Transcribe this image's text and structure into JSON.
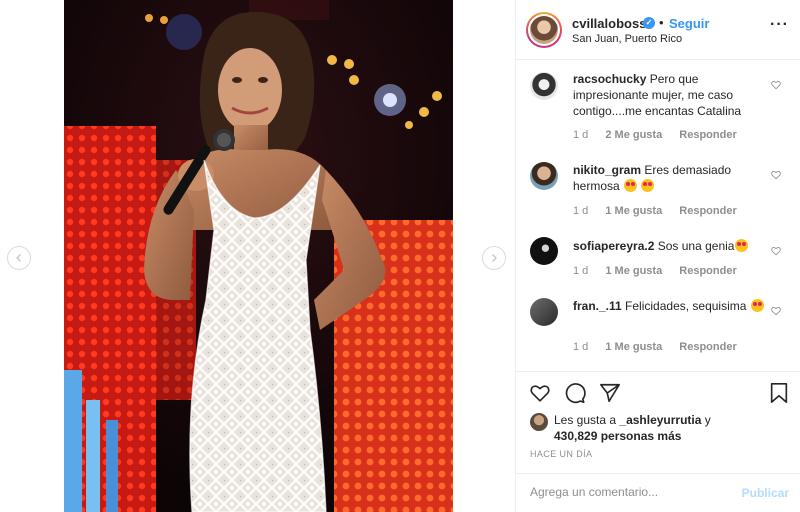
{
  "nav": {
    "prev_icon": "chevron-left-icon",
    "next_icon": "chevron-right-icon"
  },
  "post": {
    "username": "cvillaloboss",
    "dot": "•",
    "follow_label": "Seguir",
    "location": "San Juan, Puerto Rico",
    "more": "···"
  },
  "comments": [
    {
      "user": "racsochucky",
      "text": "Pero que impresionante mujer, me caso contigo....me encantas Catalina",
      "emojis": 0,
      "time": "1 d",
      "likes": "2 Me gusta",
      "reply": "Responder"
    },
    {
      "user": "nikito_gram",
      "text": "Eres demasiado hermosa",
      "emojis": 2,
      "time": "1 d",
      "likes": "1 Me gusta",
      "reply": "Responder"
    },
    {
      "user": "sofiapereyra.2",
      "text": "Sos una genia",
      "emojis": 1,
      "time": "1 d",
      "likes": "1 Me gusta",
      "reply": "Responder"
    },
    {
      "user": "fran._.11",
      "text": "Felicidades, sequisima",
      "emojis": 1,
      "time": "1 d",
      "likes": "1 Me gusta",
      "reply": "Responder"
    }
  ],
  "likes": {
    "prefix": "Les gusta a",
    "user": "_ashleyurrutia",
    "joiner": "y",
    "count": "430,829 personas más"
  },
  "timestamp": "HACE UN DÍA",
  "add_comment": {
    "placeholder": "Agrega un comentario...",
    "publish": "Publicar"
  },
  "colors": {
    "accent": "#3897f0",
    "publish_disabled": "#b3dbff",
    "meta": "#8e8e8e"
  }
}
